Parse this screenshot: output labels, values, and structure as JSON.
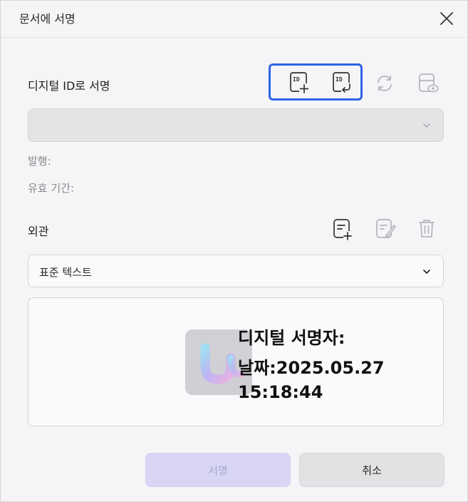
{
  "dialog": {
    "title": "문서에 서명"
  },
  "digital_id": {
    "label": "디지털 ID로 서명",
    "selected_id": "",
    "issuer_label": "발행:",
    "validity_label": "유효 기간:"
  },
  "appearance": {
    "label": "외관",
    "selected": "표준 텍스트"
  },
  "preview": {
    "line1": "디지털 서명자:",
    "line2": "날짜:2025.05.27",
    "line3": "15:18:44"
  },
  "buttons": {
    "sign": "서명",
    "cancel": "취소"
  },
  "colors": {
    "accent_outline": "#2f63e6",
    "sign_button_bg": "#d9d6f5"
  }
}
